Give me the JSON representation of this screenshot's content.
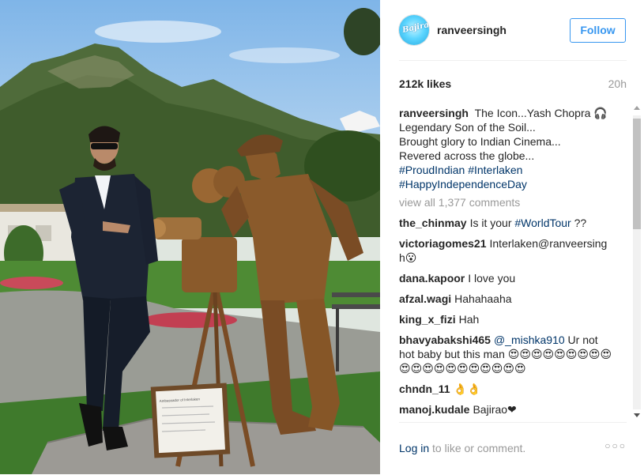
{
  "post": {
    "username": "ranveersingh",
    "avatar_text": "Bajirao",
    "follow_label": "Follow",
    "likes": "212k likes",
    "time": "20h",
    "view_all": "view all 1,377 comments",
    "caption_lines": [
      "The Icon...Yash Chopra 🎧",
      "Legendary Son of the Soil...",
      "Brought glory to Indian Cinema...",
      "Revered across the globe..."
    ],
    "caption_tags": [
      "#ProudIndian",
      "#Interlaken",
      "#HappyIndependenceDay"
    ],
    "login_text": "Log in",
    "login_suffix": " to like or comment.",
    "more_label": "○○○"
  },
  "comments": [
    {
      "user": "the_chinmay",
      "text": "Is it your ",
      "tag": "#WorldTour",
      "suffix": " ??"
    },
    {
      "user": "victoriagomes21",
      "text": "Interlaken@ranveersingh😮"
    },
    {
      "user": "dana.kapoor",
      "text": "I love you"
    },
    {
      "user": "afzal.wagi",
      "text": "Hahahaaha"
    },
    {
      "user": "king_x_fizi",
      "text": "Hah"
    },
    {
      "user": "bhavyabakshi465",
      "mention": "@_mishka910",
      "text": " Ur not hot baby but this man 😍😍😍😍😍😍😍😍😍😍😍😍😍😍😍😍😍😍😍😍"
    },
    {
      "user": "chndn_11",
      "text": "👌👌"
    },
    {
      "user": "manoj.kudale",
      "text": "Bajirao❤"
    }
  ],
  "photo": {
    "plaque_text": "Ambassador of Interlaken"
  },
  "colors": {
    "accent": "#3897f0",
    "link": "#003569",
    "muted": "#999999",
    "bronze": "#8a5a2b"
  },
  "icons": [
    "more-options-icon",
    "scroll-up-arrow-icon",
    "scroll-down-arrow-icon"
  ]
}
